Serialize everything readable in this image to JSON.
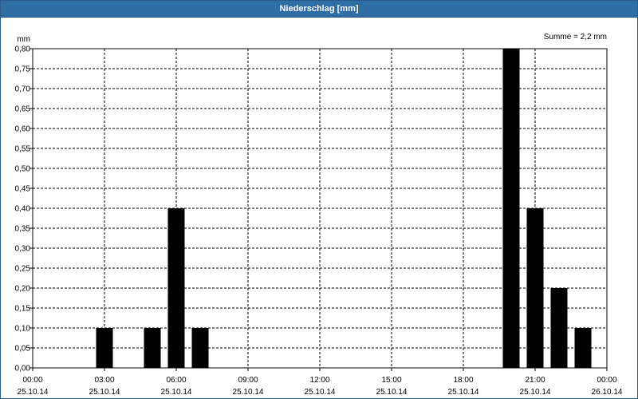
{
  "window": {
    "title": "Niederschlag [mm]"
  },
  "chart_data": {
    "type": "bar",
    "title": "Niederschlag [mm]",
    "ylabel": "mm",
    "annotation": "Summe = 2,2 mm",
    "ylim": [
      0,
      0.8
    ],
    "yticks": [
      "0,00",
      "0,05",
      "0,10",
      "0,15",
      "0,20",
      "0,25",
      "0,30",
      "0,35",
      "0,40",
      "0,45",
      "0,50",
      "0,55",
      "0,60",
      "0,65",
      "0,70",
      "0,75",
      "0,80"
    ],
    "xlim_hours": [
      0,
      24
    ],
    "xticks": [
      {
        "time": "00:00",
        "date": "25.10.14"
      },
      {
        "time": "03:00",
        "date": "25.10.14"
      },
      {
        "time": "06:00",
        "date": "25.10.14"
      },
      {
        "time": "09:00",
        "date": "25.10.14"
      },
      {
        "time": "12:00",
        "date": "25.10.14"
      },
      {
        "time": "15:00",
        "date": "25.10.14"
      },
      {
        "time": "18:00",
        "date": "25.10.14"
      },
      {
        "time": "21:00",
        "date": "25.10.14"
      },
      {
        "time": "00:00",
        "date": "26.10.14"
      }
    ],
    "bars": [
      {
        "time": "03:00",
        "value": 0.1
      },
      {
        "time": "05:00",
        "value": 0.1
      },
      {
        "time": "06:00",
        "value": 0.4
      },
      {
        "time": "07:00",
        "value": 0.1
      },
      {
        "time": "20:00",
        "value": 0.8
      },
      {
        "time": "21:00",
        "value": 0.4
      },
      {
        "time": "22:00",
        "value": 0.2
      },
      {
        "time": "23:00",
        "value": 0.1
      }
    ],
    "grid": true,
    "bar_color": "#000000"
  }
}
